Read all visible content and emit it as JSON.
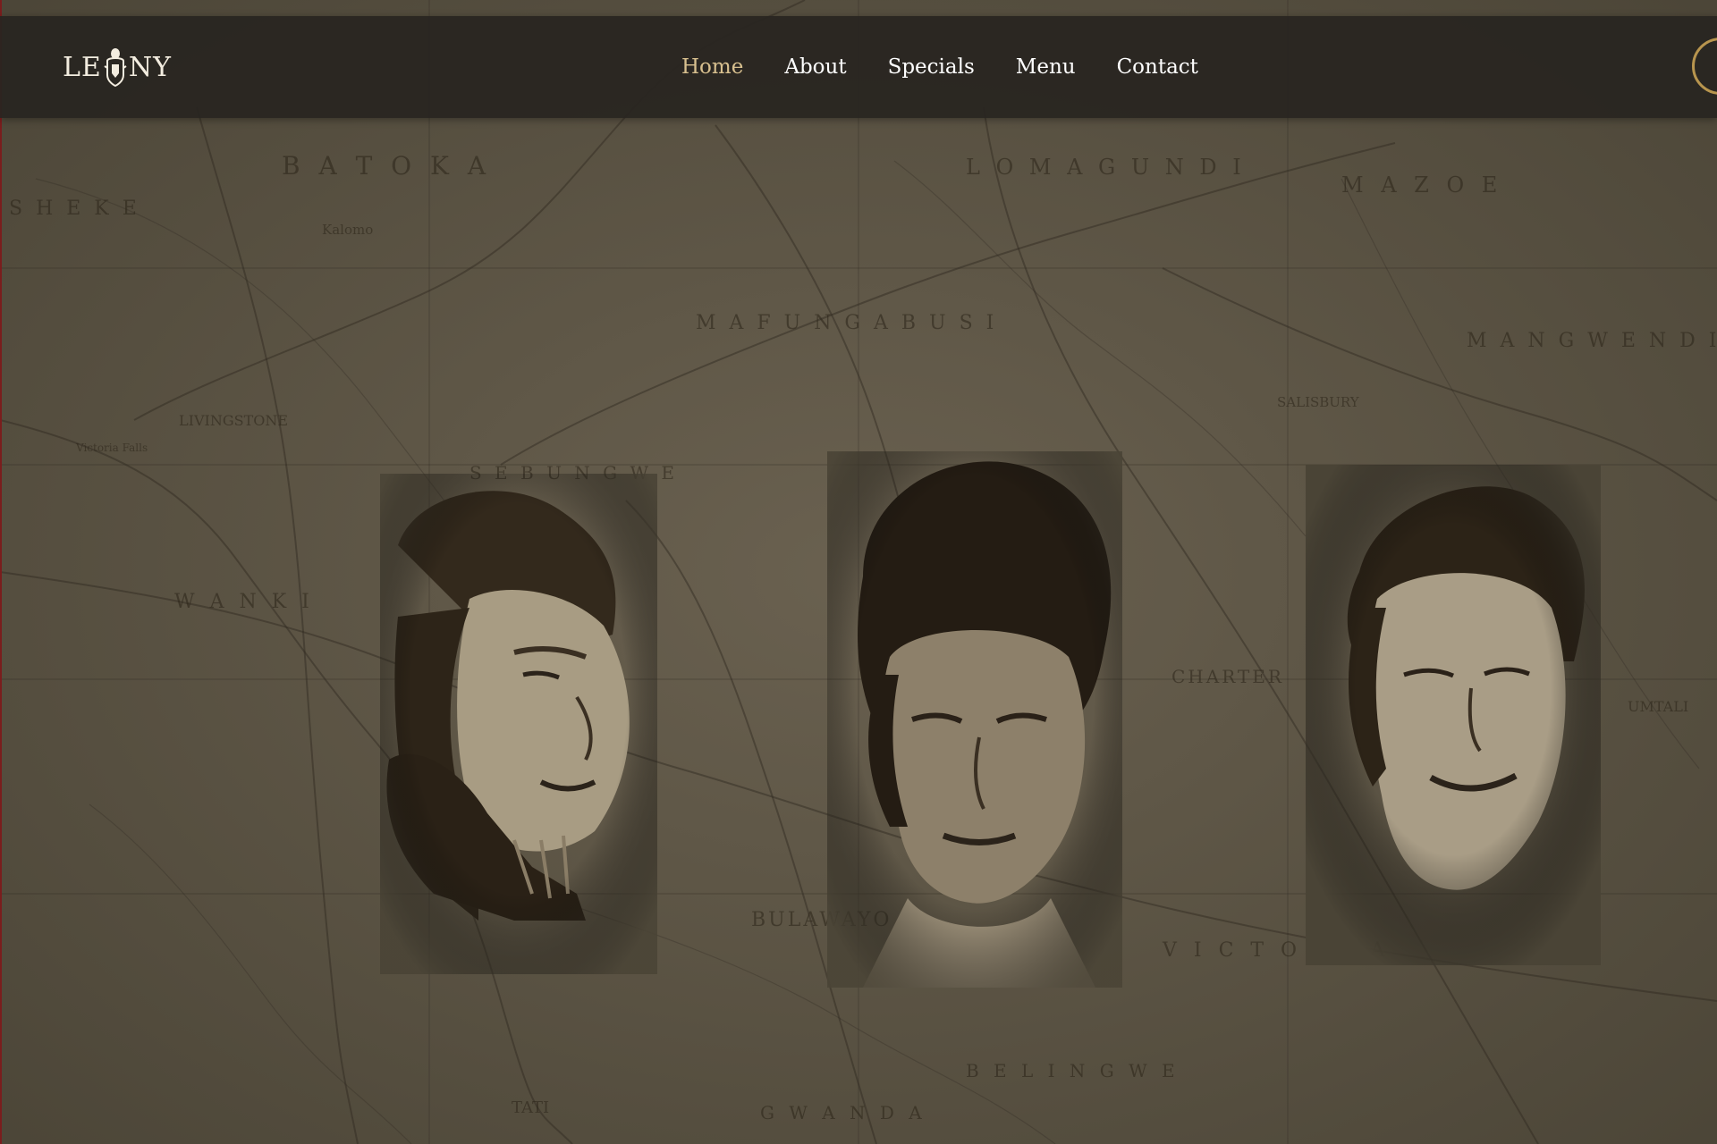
{
  "logo": {
    "left_letters": "LE",
    "right_letters": "NY",
    "emblem_icon": "crest-icon"
  },
  "nav": {
    "items": [
      {
        "label": "Home",
        "active": true
      },
      {
        "label": "About",
        "active": false
      },
      {
        "label": "Specials",
        "active": false
      },
      {
        "label": "Menu",
        "active": false
      },
      {
        "label": "Contact",
        "active": false
      }
    ]
  },
  "map_labels": {
    "batoka": "B A T O K A",
    "sheke": "S H E K E",
    "lomagundi": "L O M A G U N D I",
    "mafungabusi": "M A F U N G A B U S I",
    "mangwendi": "M A N G W E N D I",
    "mazoe": "M A Z O E",
    "livingstone": "LIVINGSTONE",
    "kalomo": "Kalomo",
    "sebungwe": "S E B U N G W E",
    "wankie": "W A N K I",
    "salisbury": "SALISBURY",
    "charter": "CHARTER",
    "bulawayo": "BULAWAYO",
    "victoria": "V I C T O R I A",
    "belingwe": "B E L I N G W E",
    "gwanda": "G W A N D A",
    "tati": "TATI",
    "umtali": "UMTALI",
    "victoria_falls": "Victoria Falls"
  },
  "colors": {
    "header_bg": "#282520",
    "nav_active": "#d8c08f",
    "nav_default": "#ffffff",
    "ring_accent": "#b8954e",
    "map_base": "#5a5242"
  }
}
